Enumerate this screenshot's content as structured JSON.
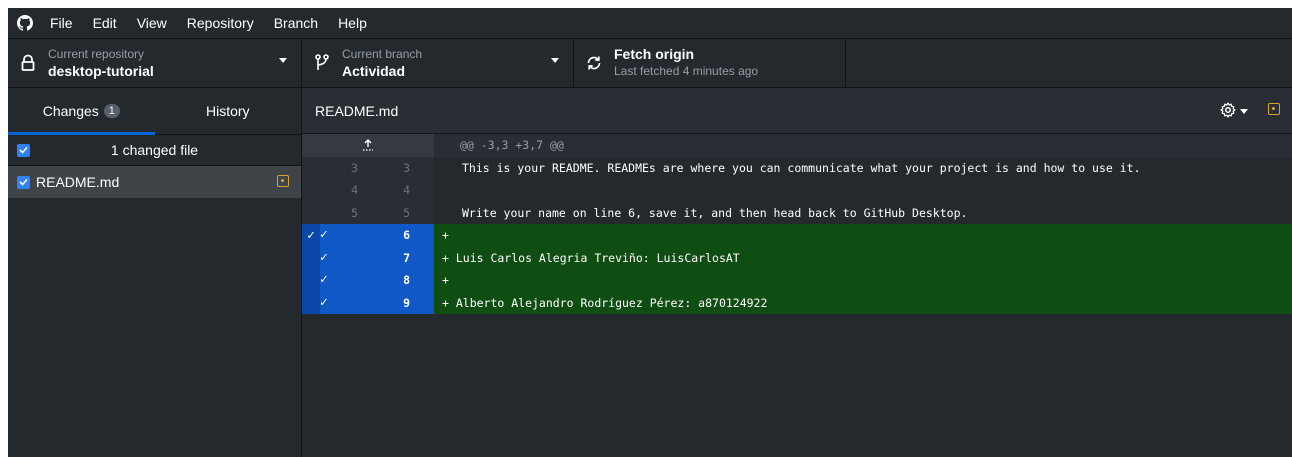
{
  "menu": {
    "items": [
      "File",
      "Edit",
      "View",
      "Repository",
      "Branch",
      "Help"
    ]
  },
  "toolbar": {
    "repo": {
      "title": "Current repository",
      "name": "desktop-tutorial"
    },
    "branch": {
      "title": "Current branch",
      "name": "Actividad"
    },
    "fetch": {
      "title": "Fetch origin",
      "sub": "Last fetched 4 minutes ago"
    }
  },
  "sidebar": {
    "tabs": {
      "changes": "Changes",
      "changes_count": "1",
      "history": "History"
    },
    "changes_header": "1 changed file",
    "files": [
      {
        "name": "README.md",
        "status": "modified"
      }
    ]
  },
  "diff": {
    "file_path": "README.md",
    "hunk_header": "@@ -3,3 +3,7 @@",
    "lines": [
      {
        "type": "ctx",
        "old": "3",
        "new": "3",
        "text": "This is your README. READMEs are where you can communicate what your project is and how to use it."
      },
      {
        "type": "ctx",
        "old": "4",
        "new": "4",
        "text": ""
      },
      {
        "type": "ctx",
        "old": "5",
        "new": "5",
        "text": "Write your name on line 6, save it, and then head back to GitHub Desktop."
      },
      {
        "type": "add",
        "old": "",
        "new": "6",
        "text": "+ "
      },
      {
        "type": "add",
        "old": "",
        "new": "7",
        "text": "+ Luis Carlos Alegria Treviño: LuisCarlosAT"
      },
      {
        "type": "add",
        "old": "",
        "new": "8",
        "text": "+ "
      },
      {
        "type": "add",
        "old": "",
        "new": "9",
        "text": "+ Alberto Alejandro Rodríguez Pérez: a870124922"
      }
    ]
  },
  "colors": {
    "background": "#24292e",
    "accent": "#0366d6",
    "added_line": "#0f4d12",
    "added_gutter": "#1158c7",
    "modified_status": "#d4a72c"
  }
}
